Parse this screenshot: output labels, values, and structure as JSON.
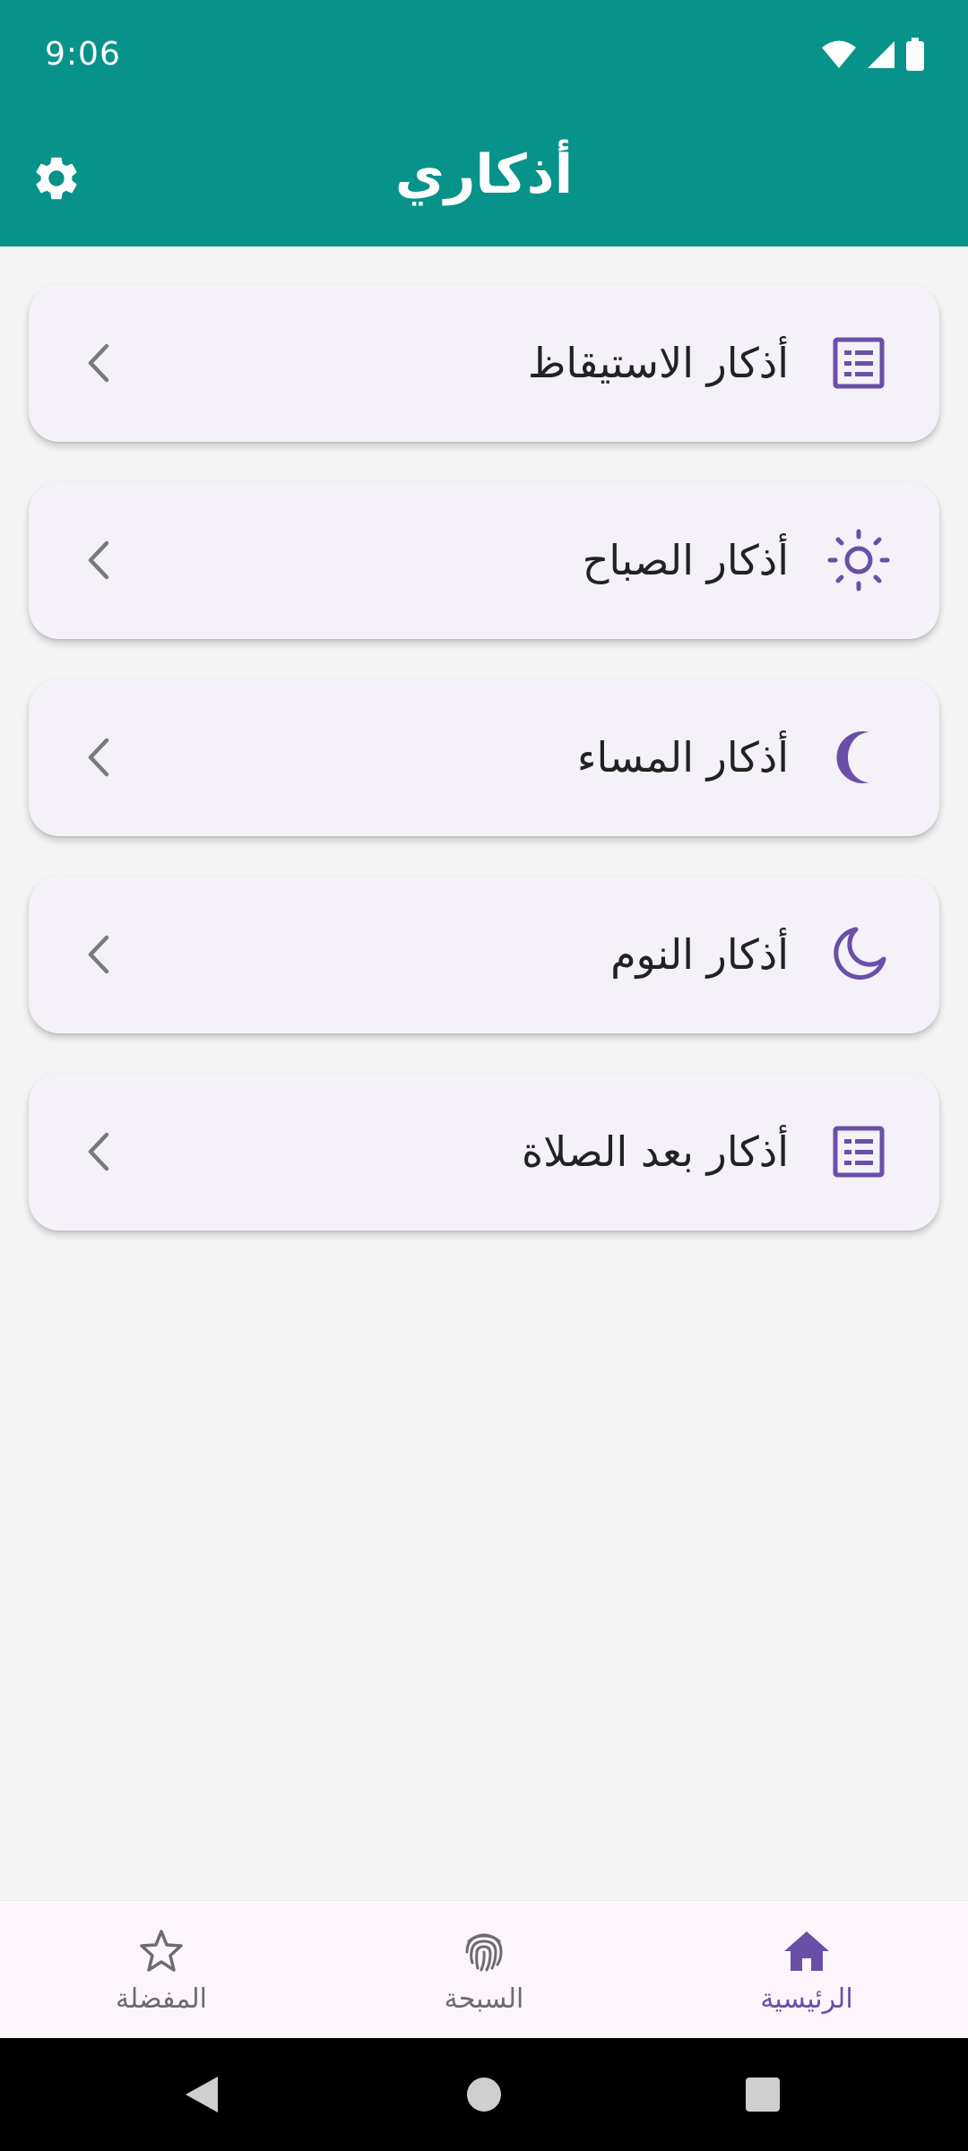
{
  "status_bar": {
    "time": "9:06"
  },
  "app_bar": {
    "title": "أذكاري",
    "settings_icon": "gear-icon"
  },
  "items": [
    {
      "label": "أذكار الاستيقاظ",
      "icon": "list-icon"
    },
    {
      "label": "أذكار الصباح",
      "icon": "sun-icon"
    },
    {
      "label": "أذكار المساء",
      "icon": "moon-filled-icon"
    },
    {
      "label": "أذكار النوم",
      "icon": "moon-outline-icon"
    },
    {
      "label": "أذكار بعد الصلاة",
      "icon": "list-icon"
    }
  ],
  "bottom_nav": {
    "home": {
      "label": "الرئيسية",
      "icon": "home-icon",
      "active": true
    },
    "tasbih": {
      "label": "السبحة",
      "icon": "fingerprint-icon",
      "active": false
    },
    "favorites": {
      "label": "المفضلة",
      "icon": "star-icon",
      "active": false
    }
  },
  "colors": {
    "primary": "#07938a",
    "accent": "#6a4fa8",
    "card": "#f4f1f8",
    "background": "#f4f4f4",
    "nav_background": "#fcf6fc"
  }
}
